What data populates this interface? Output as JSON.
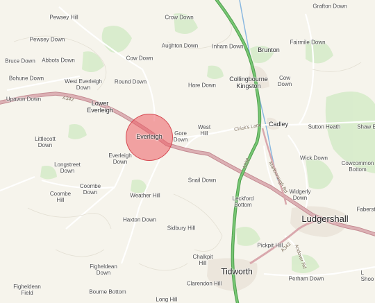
{
  "map": {
    "marker_label": "Everleigh",
    "colors": {
      "background": "#f6f4ec",
      "woodland": "#cfe8c2",
      "primary_road": "#d4a3a8",
      "primary_road_casing": "#c48b92",
      "trunk_road": "#6dbd6a",
      "minor_road": "#ffffff",
      "water": "#8ab8e0",
      "marker_fill": "#ec5c64"
    },
    "towns": [
      {
        "id": "ludgershall",
        "name": "Ludgershall"
      },
      {
        "id": "tidworth",
        "name": "Tidworth"
      }
    ],
    "villages": [
      {
        "id": "everleigh",
        "name": "Everleigh"
      },
      {
        "id": "brunton",
        "name": "Brunton"
      },
      {
        "id": "collingbourne-kingston",
        "name": "Collingbourne\nKingston"
      },
      {
        "id": "cadley",
        "name": "Cadley"
      },
      {
        "id": "lower-everleigh",
        "name": "Lower\nEverleigh"
      }
    ],
    "places": [
      {
        "id": "pewsey-hill",
        "name": "Pewsey Hill"
      },
      {
        "id": "crow-down",
        "name": "Crow Down"
      },
      {
        "id": "grafton-down",
        "name": "Grafton Down"
      },
      {
        "id": "pewsey-down",
        "name": "Pewsey Down"
      },
      {
        "id": "aughton-down",
        "name": "Aughton Down"
      },
      {
        "id": "inham-down",
        "name": "Inham Down"
      },
      {
        "id": "fairmile-down",
        "name": "Fairmile Down"
      },
      {
        "id": "bruce-down",
        "name": "Bruce Down"
      },
      {
        "id": "abbots-down",
        "name": "Abbots Down"
      },
      {
        "id": "cow-down-north",
        "name": "Cow Down"
      },
      {
        "id": "bohune-down",
        "name": "Bohune Down"
      },
      {
        "id": "west-everleigh-down",
        "name": "West Everleigh\nDown"
      },
      {
        "id": "round-down",
        "name": "Round Down"
      },
      {
        "id": "hare-down",
        "name": "Hare Down"
      },
      {
        "id": "cow-down-east",
        "name": "Cow\nDown"
      },
      {
        "id": "upavon-down",
        "name": "Upavon Down"
      },
      {
        "id": "gore-down",
        "name": "Gore\nDown"
      },
      {
        "id": "west-hill",
        "name": "West\nHill"
      },
      {
        "id": "sutton-heath",
        "name": "Sutton Heath"
      },
      {
        "id": "shaw-e",
        "name": "Shaw E"
      },
      {
        "id": "littlecott-down",
        "name": "Littlecott\nDown"
      },
      {
        "id": "everleigh-down",
        "name": "Everleigh\nDown"
      },
      {
        "id": "wick-down",
        "name": "Wick Down"
      },
      {
        "id": "cowcommon-bottom",
        "name": "Cowcommon\nBottom"
      },
      {
        "id": "longstreet-down",
        "name": "Longstreet\nDown"
      },
      {
        "id": "snail-down",
        "name": "Snail Down"
      },
      {
        "id": "widgerly-down",
        "name": "Widgerly\nDown"
      },
      {
        "id": "coombe-hill",
        "name": "Coombe\nHill"
      },
      {
        "id": "coombe-down",
        "name": "Coombe\nDown"
      },
      {
        "id": "weather-hill",
        "name": "Weather Hill"
      },
      {
        "id": "leckford-bottom",
        "name": "Leckford\nBottom"
      },
      {
        "id": "faberstown",
        "name": "Faberst"
      },
      {
        "id": "haxton-down",
        "name": "Haxton Down"
      },
      {
        "id": "sidbury-hill",
        "name": "Sidbury Hill"
      },
      {
        "id": "pickpit-hill",
        "name": "Pickpit Hill"
      },
      {
        "id": "chalkpit-hill",
        "name": "Chalkpit\nHill"
      },
      {
        "id": "figheldean-down",
        "name": "Figheldean\nDown"
      },
      {
        "id": "clarendon-hill",
        "name": "Clarendon Hill"
      },
      {
        "id": "perham-down",
        "name": "Perham Down"
      },
      {
        "id": "shoo",
        "name": "L\nShoo"
      },
      {
        "id": "figheldean-field",
        "name": "Figheldean\nField"
      },
      {
        "id": "bourne-bottom",
        "name": "Bourne Bottom"
      },
      {
        "id": "long-hill",
        "name": "Long Hill"
      }
    ],
    "road_labels": [
      {
        "id": "a342-west",
        "name": "A342"
      },
      {
        "id": "church-lane",
        "name": "Chick's Lane"
      },
      {
        "id": "marlborough-rd",
        "name": "Marlborough Rd"
      },
      {
        "id": "a338",
        "name": "A338"
      },
      {
        "id": "a342-east",
        "name": "A342"
      },
      {
        "id": "andover-rd",
        "name": "Andover Rd"
      }
    ]
  }
}
